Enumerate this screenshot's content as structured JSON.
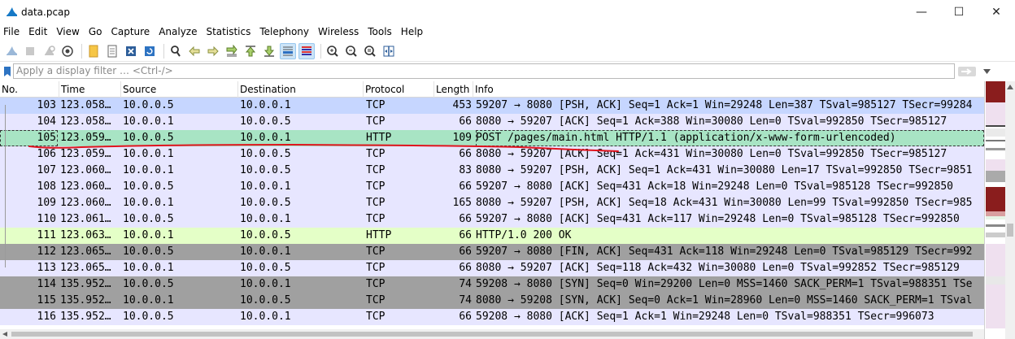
{
  "window": {
    "title": "data.pcap",
    "minimize": "—",
    "maximize": "☐",
    "close": "✕"
  },
  "menu": [
    "File",
    "Edit",
    "View",
    "Go",
    "Capture",
    "Analyze",
    "Statistics",
    "Telephony",
    "Wireless",
    "Tools",
    "Help"
  ],
  "filter": {
    "placeholder": "Apply a display filter … <Ctrl-/>"
  },
  "columns": [
    "No.",
    "Time",
    "Source",
    "Destination",
    "Protocol",
    "Length",
    "Info"
  ],
  "packets": [
    {
      "no": "103",
      "time": "123.058…",
      "src": "10.0.0.5",
      "dst": "10.0.0.1",
      "proto": "TCP",
      "len": "453",
      "info": "59207 → 8080 [PSH, ACK] Seq=1 Ack=1 Win=29248 Len=387 TSval=985127 TSecr=99284",
      "bg": "#c6d6ff",
      "fg": "#000000"
    },
    {
      "no": "104",
      "time": "123.058…",
      "src": "10.0.0.1",
      "dst": "10.0.0.5",
      "proto": "TCP",
      "len": "66",
      "info": "8080 → 59207 [ACK] Seq=1 Ack=388 Win=30080 Len=0 TSval=992850 TSecr=985127",
      "bg": "#e7e6ff",
      "fg": "#000000"
    },
    {
      "no": "105",
      "time": "123.059…",
      "src": "10.0.0.5",
      "dst": "10.0.0.1",
      "proto": "HTTP",
      "len": "109",
      "info": "POST /pages/main.html HTTP/1.1  (application/x-www-form-urlencoded)",
      "bg": "#a8e4c4",
      "fg": "#000000"
    },
    {
      "no": "106",
      "time": "123.059…",
      "src": "10.0.0.1",
      "dst": "10.0.0.5",
      "proto": "TCP",
      "len": "66",
      "info": "8080 → 59207 [ACK] Seq=1 Ack=431 Win=30080 Len=0 TSval=992850 TSecr=985127",
      "bg": "#e7e6ff",
      "fg": "#000000"
    },
    {
      "no": "107",
      "time": "123.060…",
      "src": "10.0.0.1",
      "dst": "10.0.0.5",
      "proto": "TCP",
      "len": "83",
      "info": "8080 → 59207 [PSH, ACK] Seq=1 Ack=431 Win=30080 Len=17 TSval=992850 TSecr=9851",
      "bg": "#e7e6ff",
      "fg": "#000000"
    },
    {
      "no": "108",
      "time": "123.060…",
      "src": "10.0.0.5",
      "dst": "10.0.0.1",
      "proto": "TCP",
      "len": "66",
      "info": "59207 → 8080 [ACK] Seq=431 Ack=18 Win=29248 Len=0 TSval=985128 TSecr=992850",
      "bg": "#e7e6ff",
      "fg": "#000000"
    },
    {
      "no": "109",
      "time": "123.060…",
      "src": "10.0.0.1",
      "dst": "10.0.0.5",
      "proto": "TCP",
      "len": "165",
      "info": "8080 → 59207 [PSH, ACK] Seq=18 Ack=431 Win=30080 Len=99 TSval=992850 TSecr=985",
      "bg": "#e7e6ff",
      "fg": "#000000"
    },
    {
      "no": "110",
      "time": "123.061…",
      "src": "10.0.0.5",
      "dst": "10.0.0.1",
      "proto": "TCP",
      "len": "66",
      "info": "59207 → 8080 [ACK] Seq=431 Ack=117 Win=29248 Len=0 TSval=985128 TSecr=992850",
      "bg": "#e7e6ff",
      "fg": "#000000"
    },
    {
      "no": "111",
      "time": "123.063…",
      "src": "10.0.0.1",
      "dst": "10.0.0.5",
      "proto": "HTTP",
      "len": "66",
      "info": "HTTP/1.0 200 OK",
      "bg": "#e4ffc7",
      "fg": "#000000"
    },
    {
      "no": "112",
      "time": "123.065…",
      "src": "10.0.0.5",
      "dst": "10.0.0.1",
      "proto": "TCP",
      "len": "66",
      "info": "59207 → 8080 [FIN, ACK] Seq=431 Ack=118 Win=29248 Len=0 TSval=985129 TSecr=992",
      "bg": "#a0a0a0",
      "fg": "#000000"
    },
    {
      "no": "113",
      "time": "123.065…",
      "src": "10.0.0.1",
      "dst": "10.0.0.5",
      "proto": "TCP",
      "len": "66",
      "info": "8080 → 59207 [ACK] Seq=118 Ack=432 Win=30080 Len=0 TSval=992852 TSecr=985129",
      "bg": "#e7e6ff",
      "fg": "#000000"
    },
    {
      "no": "114",
      "time": "135.952…",
      "src": "10.0.0.5",
      "dst": "10.0.0.1",
      "proto": "TCP",
      "len": "74",
      "info": "59208 → 8080 [SYN] Seq=0 Win=29200 Len=0 MSS=1460 SACK_PERM=1 TSval=988351 TSe",
      "bg": "#a0a0a0",
      "fg": "#000000"
    },
    {
      "no": "115",
      "time": "135.952…",
      "src": "10.0.0.1",
      "dst": "10.0.0.5",
      "proto": "TCP",
      "len": "74",
      "info": "8080 → 59208 [SYN, ACK] Seq=0 Ack=1 Win=28960 Len=0 MSS=1460 SACK_PERM=1 TSval",
      "bg": "#a0a0a0",
      "fg": "#000000"
    },
    {
      "no": "116",
      "time": "135.952…",
      "src": "10.0.0.5",
      "dst": "10.0.0.1",
      "proto": "TCP",
      "len": "66",
      "info": "59208 → 8080 [ACK] Seq=1 Ack=1 Win=29248 Len=0 TSval=988351 TSecr=996073",
      "bg": "#e7e6ff",
      "fg": "#000000"
    }
  ],
  "selected_row": 2,
  "colors": {
    "annotation": "#e0141e"
  },
  "icons": {
    "app": "shark-fin-icon",
    "bookmark": "bookmark-icon",
    "apply": "apply-arrow-icon"
  }
}
